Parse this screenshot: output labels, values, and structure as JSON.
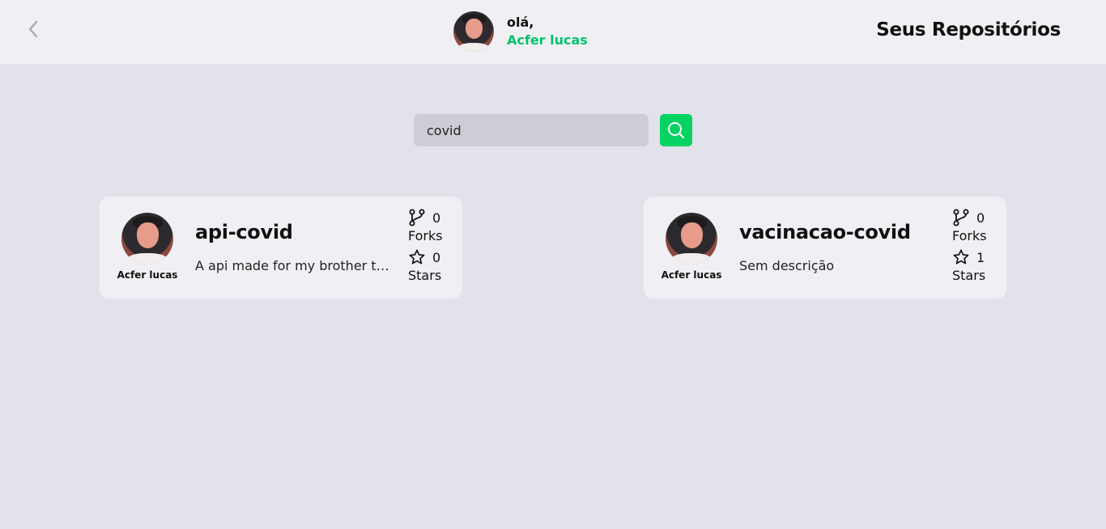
{
  "header": {
    "back_icon": "chevron-left-icon",
    "greeting": "olá,",
    "user_name": "Acfer lucas",
    "title": "Seus Repositórios"
  },
  "search": {
    "value": "covid",
    "button_icon": "search-icon"
  },
  "repos": [
    {
      "name": "api-covid",
      "description": "A api made for my brother to do the covid stuff",
      "owner": "Acfer lucas",
      "forks": "0",
      "forks_label": "Forks",
      "stars": "0",
      "stars_label": "Stars"
    },
    {
      "name": "vacinacao-covid",
      "description": "Sem descrição",
      "owner": "Acfer lucas",
      "forks": "0",
      "forks_label": "Forks",
      "stars": "1",
      "stars_label": "Stars"
    }
  ],
  "colors": {
    "accent": "#04d361",
    "background": "#e2e2ea",
    "header_bg": "#f0f0f4",
    "card_bg": "#f0f0f4"
  }
}
